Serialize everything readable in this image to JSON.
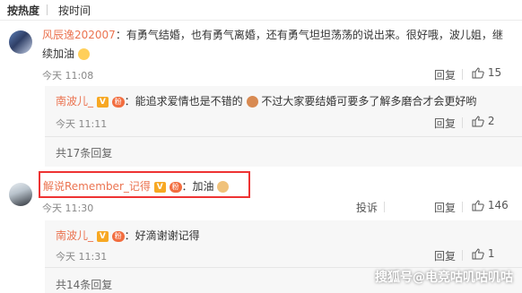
{
  "sort": {
    "hot_label": "按热度",
    "time_label": "按时间"
  },
  "comments": [
    {
      "username": "风辰逸202007",
      "text": "：有勇气结婚，也有勇气离婚，还有勇气坦坦荡荡的说出来。很好哦，波儿姐，继",
      "text_cont": "续加油",
      "time": "今天 11:08",
      "reply_label": "回复",
      "likes": "15"
    },
    {
      "username": "解说Remember_记得",
      "text": "：加油",
      "time": "今天 11:30",
      "forward_label": "投诉",
      "reply_label": "回复",
      "likes": "146"
    }
  ],
  "replies": [
    {
      "username": "南波儿_",
      "text_a": "：能追求爱情也是不错的",
      "text_b": "不过大家要结婚可要多了解多磨合才会更好哟",
      "time": "今天 11:11",
      "reply_label": "回复",
      "likes": "2",
      "count_label": "共17条回复"
    },
    {
      "username": "南波儿_",
      "text_a": "：好滴谢谢记得",
      "time": "今天 11:31",
      "reply_label": "回复",
      "likes": "1",
      "count_label": "共14条回复"
    }
  ],
  "badges": {
    "v": "V",
    "fan": "粉"
  },
  "watermark": "搜狐号@电竞咕叽咕叽咕",
  "colors": {
    "username": "#eb7350",
    "highlight": "#e33333"
  }
}
